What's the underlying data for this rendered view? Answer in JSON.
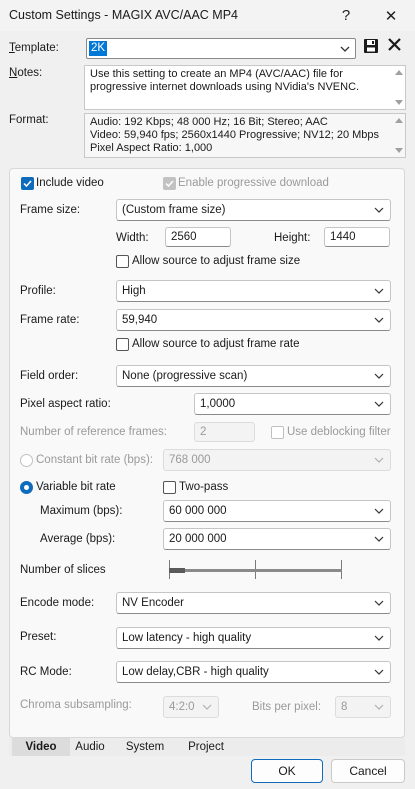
{
  "window": {
    "title": "Custom Settings - MAGIX AVC/AAC MP4",
    "help_glyph": "?",
    "close_glyph": "✕"
  },
  "template": {
    "label": "Template:",
    "label_underline": "T",
    "label_rest": "emplate:",
    "value": "2K"
  },
  "notes": {
    "label": "Notes:",
    "label_underline": "N",
    "label_rest": "otes:",
    "text": "Use this setting to create an MP4 (AVC/AAC) file for progressive internet downloads using NVidia's NVENC."
  },
  "format": {
    "label": "Format:",
    "lines": [
      "Audio: 192 Kbps; 48 000 Hz; 16 Bit; Stereo; AAC",
      "Video: 59,940 fps; 2560x1440 Progressive; NV12; 20 Mbps",
      "Pixel Aspect Ratio: 1,000"
    ]
  },
  "video": {
    "include_video": {
      "label": "Include video",
      "checked": true
    },
    "progressive_download": {
      "label": "Enable progressive download",
      "checked": true,
      "disabled": true
    },
    "frame_size": {
      "label": "Frame size:",
      "value": "(Custom frame size)"
    },
    "width": {
      "label": "Width:",
      "value": "2560"
    },
    "height": {
      "label": "Height:",
      "value": "1440"
    },
    "allow_frame_size": {
      "label": "Allow source to adjust frame size",
      "checked": false
    },
    "profile": {
      "label": "Profile:",
      "value": "High"
    },
    "frame_rate": {
      "label": "Frame rate:",
      "value": "59,940"
    },
    "allow_frame_rate": {
      "label": "Allow source to adjust frame rate",
      "checked": false
    },
    "field_order": {
      "label": "Field order:",
      "value": "None (progressive scan)"
    },
    "pixel_aspect": {
      "label": "Pixel aspect ratio:",
      "value": "1,0000"
    },
    "ref_frames": {
      "label": "Number of reference frames:",
      "value": "2"
    },
    "deblocking": {
      "label": "Use deblocking filter",
      "checked": false
    },
    "constant_bit_rate": {
      "label": "Constant bit rate (bps):",
      "value": "768 000",
      "selected": false
    },
    "variable_bit_rate": {
      "label": "Variable bit rate",
      "selected": true
    },
    "two_pass": {
      "label": "Two-pass",
      "checked": false
    },
    "maximum": {
      "label": "Maximum (bps):",
      "value": "60 000 000"
    },
    "average": {
      "label": "Average (bps):",
      "value": "20 000 000"
    },
    "slices": {
      "label": "Number of slices",
      "level": 0
    },
    "encode_mode": {
      "label": "Encode mode:",
      "value": "NV Encoder"
    },
    "preset": {
      "label": "Preset:",
      "value": "Low latency - high quality"
    },
    "rc_mode": {
      "label": "RC Mode:",
      "value": "Low delay,CBR - high quality"
    },
    "chroma": {
      "label": "Chroma subsampling:",
      "value": "4:2:0"
    },
    "bits_per_pixel": {
      "label": "Bits per pixel:",
      "value": "8"
    }
  },
  "tabs": [
    "Video",
    "Audio",
    "System",
    "Project"
  ],
  "active_tab": "Video",
  "buttons": {
    "ok": "OK",
    "cancel": "Cancel"
  },
  "colors": {
    "accent": "#0f6cbd",
    "panel": "#f9f9f9",
    "window": "#f0f0f0"
  }
}
